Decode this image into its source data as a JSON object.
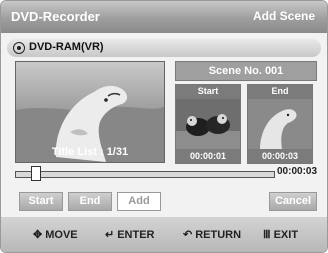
{
  "header": {
    "title": "DVD-Recorder",
    "mode": "Add Scene"
  },
  "disc": {
    "label": "DVD-RAM(VR)"
  },
  "preview": {
    "caption": "Title List : 1/31"
  },
  "scene": {
    "header": "Scene No. 001",
    "start": {
      "label": "Start",
      "time": "00:00:01"
    },
    "end": {
      "label": "End",
      "time": "00:00:03"
    }
  },
  "timeline": {
    "total_time": "00:00:03",
    "progress_fraction": 0.05
  },
  "buttons": {
    "start": "Start",
    "end": "End",
    "add": "Add",
    "cancel": "Cancel"
  },
  "footer": {
    "move": "MOVE",
    "enter": "ENTER",
    "return": "RETURN",
    "exit": "EXIT"
  },
  "icons": {
    "move": "move-arrows-icon",
    "enter": "enter-icon",
    "return": "return-icon",
    "exit": "exit-icon",
    "disc": "disc-icon"
  },
  "colors": {
    "selected_button": "#ffffff",
    "title_bar": "#9e9e9e",
    "footer_bar": "#c4c4c4"
  }
}
